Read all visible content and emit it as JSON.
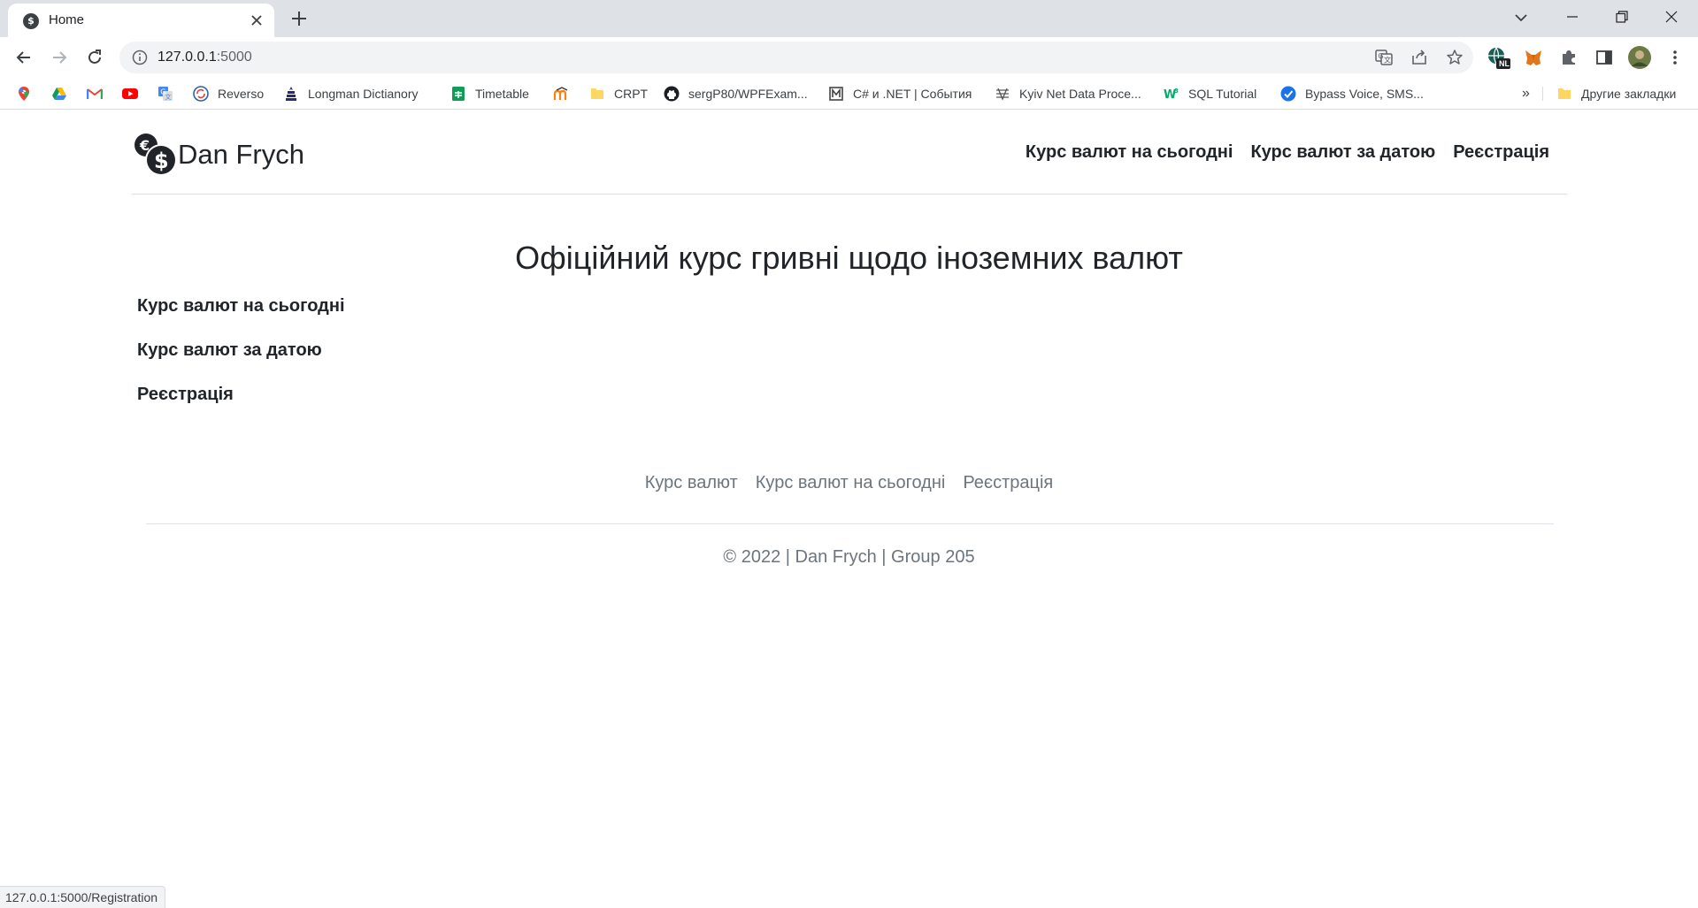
{
  "browser": {
    "tab": {
      "title": "Home",
      "favicon": "dollar-coin-icon"
    },
    "address": {
      "host": "127.0.0.1",
      "port": ":5000"
    },
    "bookmarks": [
      {
        "label": "",
        "icon": "google-maps-icon"
      },
      {
        "label": "",
        "icon": "google-drive-icon"
      },
      {
        "label": "",
        "icon": "gmail-icon"
      },
      {
        "label": "",
        "icon": "youtube-icon"
      },
      {
        "label": "",
        "icon": "google-translate-icon"
      },
      {
        "label": "Reverso",
        "icon": "reverso-icon"
      },
      {
        "label": "Longman Dictianory",
        "icon": "longman-icon"
      },
      {
        "label": "Timetable",
        "icon": "google-sheets-icon"
      },
      {
        "label": "",
        "icon": "moodle-icon"
      },
      {
        "label": "CRPT",
        "icon": "folder-icon"
      },
      {
        "label": "sergP80/WPFExam...",
        "icon": "github-icon"
      },
      {
        "label": "C# и .NET | События",
        "icon": "metanit-icon"
      },
      {
        "label": "Kyiv Net Data Proce...",
        "icon": "site-icon"
      },
      {
        "label": "SQL Tutorial",
        "icon": "w3schools-icon"
      },
      {
        "label": "Bypass Voice, SMS...",
        "icon": "check-badge-icon"
      }
    ],
    "other_bookmarks": "Другие закладки",
    "profile_badge": "NL",
    "status_url": "127.0.0.1:5000/Registration"
  },
  "header": {
    "brand": "Dan Frych",
    "nav": [
      "Курс валют на сьогодні",
      "Курс валют за датою",
      "Реєстрація"
    ]
  },
  "main": {
    "title": "Офіційний курс гривні щодо іноземних валют",
    "links": [
      "Курс валют на сьогодні",
      "Курс валют за датою",
      "Реєстрація"
    ]
  },
  "footer": {
    "nav": [
      "Курс валют",
      "Курс валют на сьогодні",
      "Реєстрація"
    ],
    "copyright": "© 2022 | Dan Frych | Group 205"
  },
  "colors": {
    "text": "#212529",
    "muted": "#6c757d",
    "divider": "#dee2e6",
    "chrome_tabstrip": "#dee1e6",
    "omnibox": "#f1f3f4"
  }
}
